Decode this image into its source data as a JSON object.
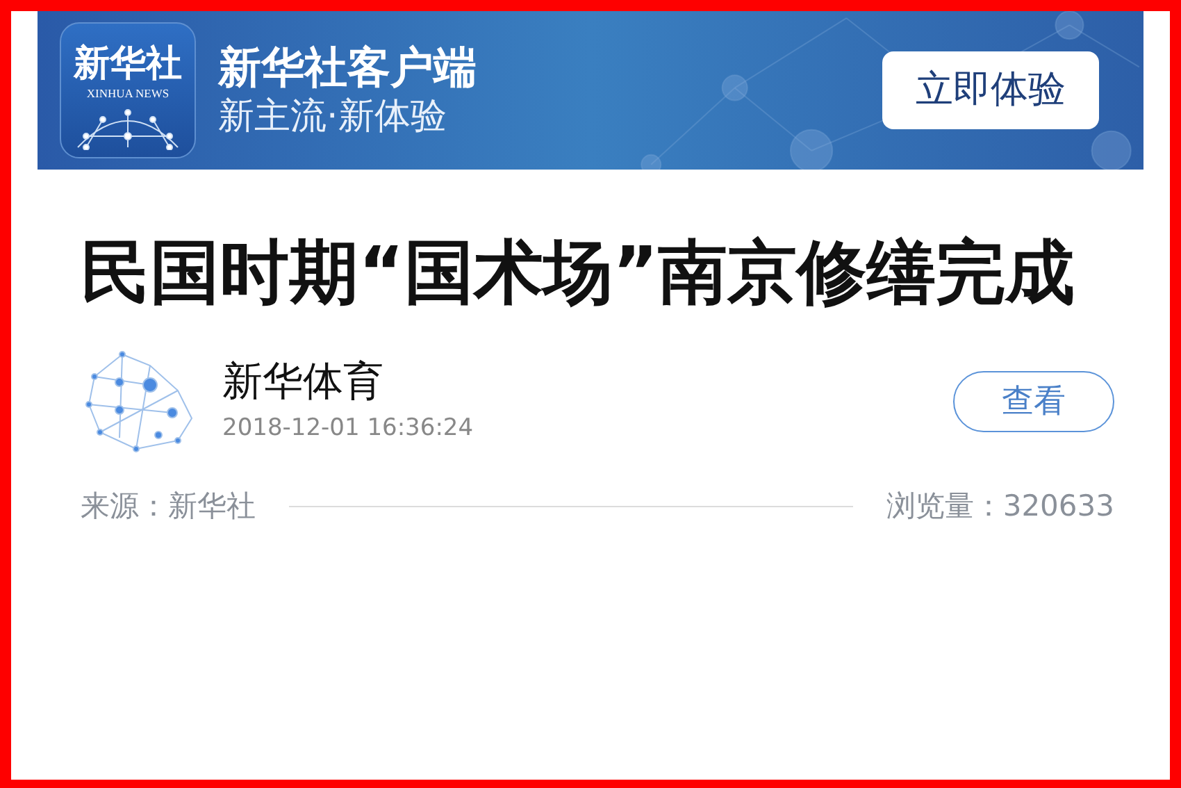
{
  "banner": {
    "logo_text": "新华社",
    "logo_subtext": "XINHUA NEWS",
    "title": "新华社客户端",
    "subtitle": "新主流·新体验",
    "button": "立即体验"
  },
  "article": {
    "title": "民国时期“国术场”南京修缮完成"
  },
  "author": {
    "name": "新华体育",
    "time": "2018-12-01 16:36:24",
    "button": "查看"
  },
  "footer": {
    "source": "来源：新华社",
    "views": "浏览量：320633"
  }
}
